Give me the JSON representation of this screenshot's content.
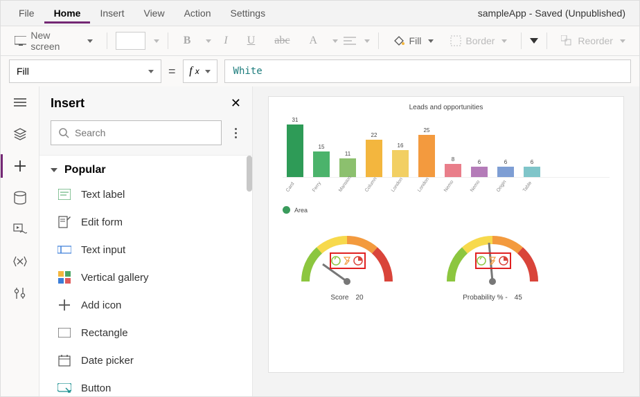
{
  "menu": {
    "items": [
      "File",
      "Home",
      "Insert",
      "View",
      "Action",
      "Settings"
    ],
    "active_index": 1
  },
  "status": "sampleApp - Saved (Unpublished)",
  "ribbon": {
    "new_screen": "New screen",
    "fill": "Fill",
    "border": "Border",
    "reorder": "Reorder"
  },
  "formula": {
    "property": "Fill",
    "value": "White"
  },
  "insert_pane": {
    "title": "Insert",
    "search_placeholder": "Search",
    "group_label": "Popular",
    "items": [
      "Text label",
      "Edit form",
      "Text input",
      "Vertical gallery",
      "Add icon",
      "Rectangle",
      "Date picker",
      "Button"
    ]
  },
  "chart_data": {
    "type": "bar",
    "title": "Leads and opportunities",
    "categories": [
      "Card",
      "Ferry",
      "Mansion",
      "Column",
      "London",
      "London",
      "Nemo",
      "Nemo",
      "Origin",
      "Table"
    ],
    "values": [
      31,
      15,
      11,
      22,
      16,
      25,
      8,
      6,
      6,
      6
    ],
    "colors": [
      "#2e9b57",
      "#4bb36b",
      "#8cc06e",
      "#f3b63e",
      "#f2cf62",
      "#f39a3e",
      "#e97e8a",
      "#b47bb8",
      "#7e9ed4",
      "#7fc5c9"
    ],
    "legend": "Area",
    "ylim": [
      0,
      32
    ]
  },
  "gauges": [
    {
      "label": "Score",
      "value": "20"
    },
    {
      "label": "Probability % -",
      "value": "45"
    }
  ]
}
